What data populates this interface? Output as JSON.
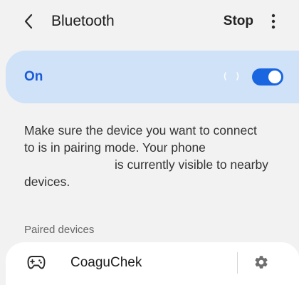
{
  "header": {
    "title": "Bluetooth",
    "stop_label": "Stop"
  },
  "toggle": {
    "label": "On",
    "state": true,
    "accent_color": "#1a66e0",
    "card_color": "#cfe2f8"
  },
  "description": {
    "line1": "Make sure the device you want to connect",
    "line2": "to is in pairing mode. Your phone",
    "line3": "is currently visible to nearby",
    "line4": "devices."
  },
  "paired_section": {
    "title": "Paired devices",
    "devices": [
      {
        "name": "CoaguChek",
        "icon": "gamepad-icon",
        "settings_icon": "gear-icon"
      }
    ]
  },
  "icons": {
    "back": "chevron-left-icon",
    "more": "more-vertical-icon"
  }
}
